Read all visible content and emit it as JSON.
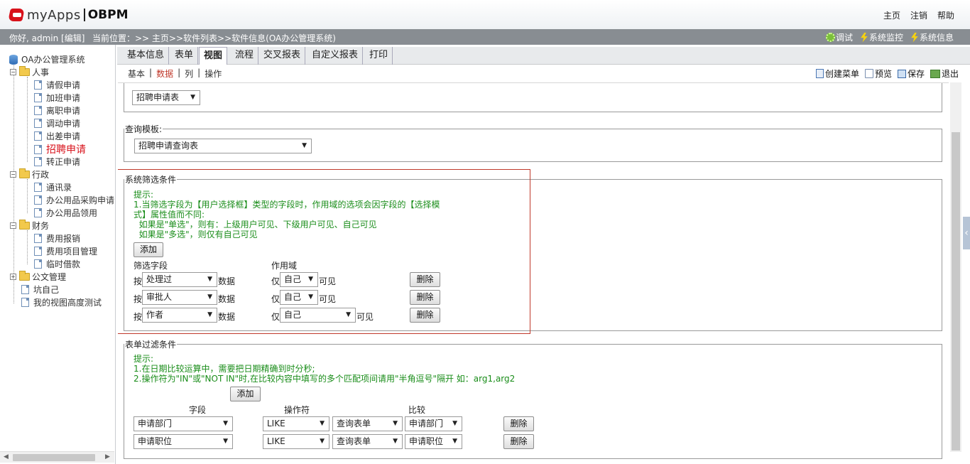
{
  "header": {
    "logo_text": "myApps",
    "logo_product": "OBPM",
    "links": [
      "主页",
      "注销",
      "帮助"
    ]
  },
  "statusbar": {
    "greeting": "你好, admin [编辑]",
    "location": "当前位置：>> 主页>>软件列表>>软件信息(OA办公管理系统)",
    "tools": [
      {
        "label": "调试",
        "icon": "debug-gear-icon"
      },
      {
        "label": "系统监控",
        "icon": "lightning-icon"
      },
      {
        "label": "系统信息",
        "icon": "lightning-icon"
      }
    ]
  },
  "tree": {
    "root": "OA办公管理系统",
    "groups": [
      {
        "label": "人事",
        "items": [
          "请假申请",
          "加班申请",
          "离职申请",
          "调动申请",
          "出差申请",
          "招聘申请",
          "转正申请"
        ],
        "active": "招聘申请"
      },
      {
        "label": "行政",
        "items": [
          "通讯录",
          "办公用品采购申请",
          "办公用品领用"
        ]
      },
      {
        "label": "财务",
        "items": [
          "费用报销",
          "费用项目管理",
          "临时借款"
        ]
      },
      {
        "label": "公文管理",
        "items": []
      }
    ],
    "extra_items": [
      "坑自己",
      "我的视图高度测试"
    ]
  },
  "tabs": [
    "基本信息",
    "表单",
    "视图",
    "流程",
    "交叉报表",
    "自定义报表",
    "打印"
  ],
  "active_tab": "视图",
  "subnav": [
    "基本",
    "数据",
    "列",
    "操作"
  ],
  "active_subnav": "数据",
  "actions": [
    "创建菜单",
    "预览",
    "保存",
    "退出"
  ],
  "form_select": "招聘申请表",
  "query_template": {
    "legend": "查询模板:",
    "value": "招聘申请查询表"
  },
  "system_filter": {
    "legend": "系统筛选条件",
    "hint_title": "提示:",
    "hint_lines": [
      "1.当筛选字段为【用户选择框】类型的字段时，作用域的选项会因字段的【选择模",
      "式】属性值而不同:",
      "  如果是\"单选\"，则有：上级用户可见、下级用户可见、自己可见",
      "  如果是\"多选\"，则仅有自己可见"
    ],
    "add_label": "添加",
    "col_field": "筛选字段",
    "col_scope": "作用域",
    "prefix": "按",
    "data_suffix": "数据",
    "only": "仅",
    "visible": "可见",
    "delete_label": "删除",
    "rows": [
      {
        "field": "处理过",
        "scope": "自己"
      },
      {
        "field": "审批人",
        "scope": "自己"
      },
      {
        "field": "作者",
        "scope": "自己"
      }
    ]
  },
  "form_filter": {
    "legend": "表单过滤条件",
    "hint_title": "提示:",
    "hint_lines": [
      "1.在日期比较运算中，需要把日期精确到时分秒;",
      "2.操作符为\"IN\"或\"NOT IN\"时,在比较内容中填写的多个匹配项间请用\"半角逗号\"隔开 如：arg1,arg2"
    ],
    "add_label": "添加",
    "col_field": "字段",
    "col_op": "操作符",
    "col_compare": "比较",
    "delete_label": "删除",
    "rows": [
      {
        "field": "申请部门",
        "op": "LIKE",
        "source": "查询表单",
        "compare": "申请部门"
      },
      {
        "field": "申请职位",
        "op": "LIKE",
        "source": "查询表单",
        "compare": "申请职位"
      }
    ]
  },
  "colors": {
    "accent_red": "#d8121b",
    "hint_green": "#1a8d1a",
    "statusbar": "#888d92"
  }
}
